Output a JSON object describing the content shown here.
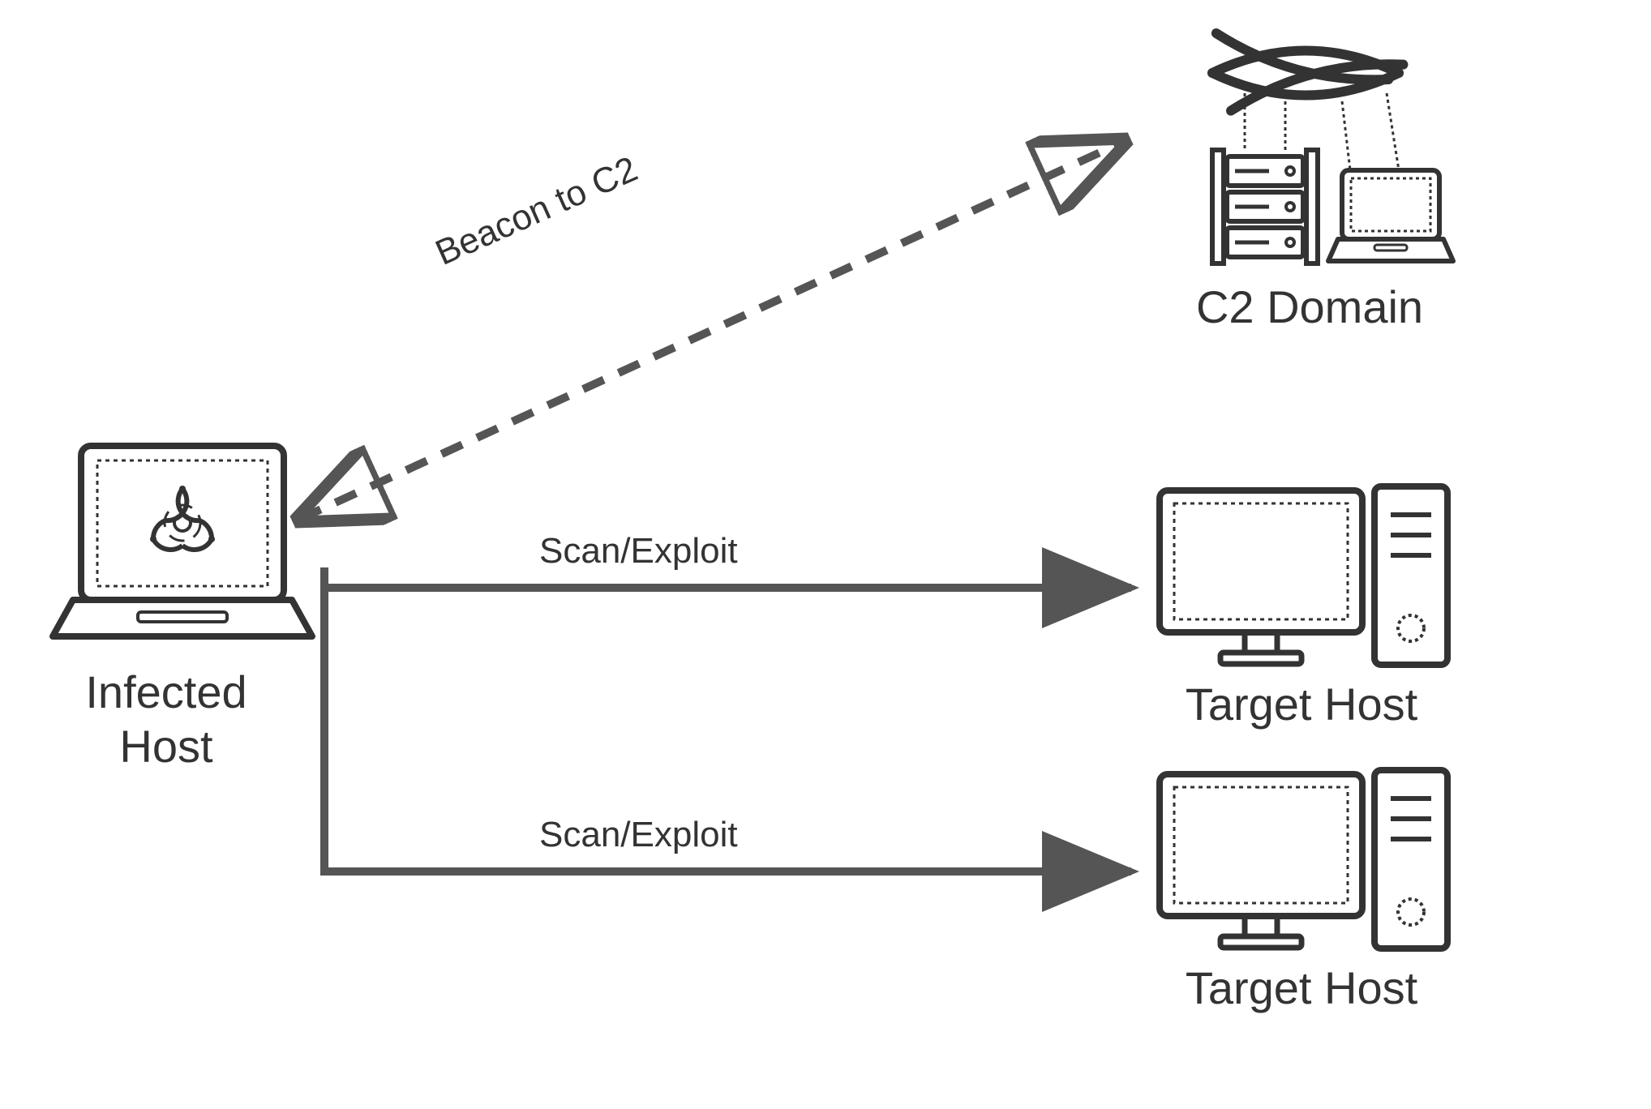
{
  "nodes": {
    "infected_host": {
      "label": "Infected\nHost"
    },
    "c2_domain": {
      "label": "C2 Domain"
    },
    "target_host_1": {
      "label": "Target Host"
    },
    "target_host_2": {
      "label": "Target Host"
    }
  },
  "edges": {
    "beacon": {
      "label": "Beacon to C2"
    },
    "scan_exploit_1": {
      "label": "Scan/Exploit"
    },
    "scan_exploit_2": {
      "label": "Scan/Exploit"
    }
  },
  "colors": {
    "stroke": "#555555",
    "text": "#333333"
  }
}
